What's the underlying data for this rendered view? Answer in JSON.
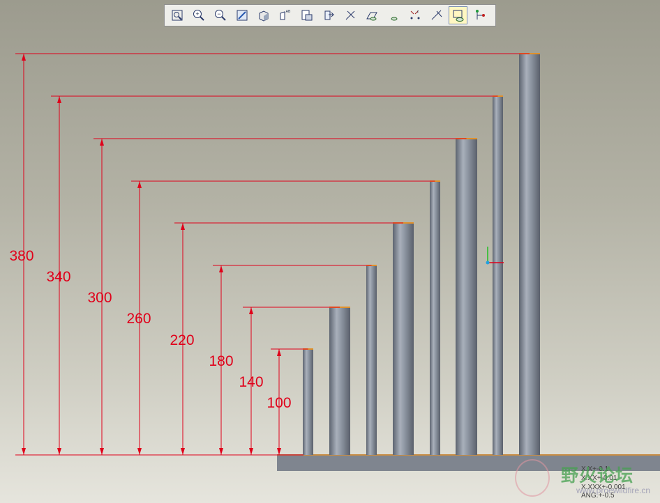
{
  "toolbar": {
    "buttons": [
      {
        "icon": "refit-icon",
        "label": "Refit"
      },
      {
        "icon": "zoom-in-icon",
        "label": "Zoom In"
      },
      {
        "icon": "zoom-out-icon",
        "label": "Zoom Out"
      },
      {
        "icon": "repaint-icon",
        "label": "Repaint"
      },
      {
        "icon": "shading-icon",
        "label": "Shading"
      },
      {
        "icon": "view-manager-icon",
        "label": "View Manager"
      },
      {
        "icon": "saved-views-icon",
        "label": "Saved Views"
      },
      {
        "icon": "orient-icon",
        "label": "Orient"
      },
      {
        "icon": "datum-planes-icon",
        "label": "Datum Planes"
      },
      {
        "icon": "datum-axes-icon",
        "label": "Datum Axes"
      },
      {
        "icon": "datum-points-icon",
        "label": "Datum Points"
      },
      {
        "icon": "coordinate-systems-icon",
        "label": "Coordinate Systems"
      },
      {
        "icon": "spin-center-icon",
        "label": "Spin Center"
      },
      {
        "icon": "annotation-display-icon",
        "label": "Annotation Display",
        "active": true
      },
      {
        "icon": "model-tree-icon",
        "label": "Model Tree"
      }
    ],
    "glyphs": {
      "zoom_in": "+",
      "zoom_out": "−",
      "view_label": "AB",
      "axes_label": "/",
      "coord_label": "z"
    }
  },
  "dimensions": {
    "values": [
      "380",
      "340",
      "300",
      "260",
      "220",
      "180",
      "140",
      "100"
    ],
    "color": "#e0001a",
    "unit": ""
  },
  "model": {
    "pillar_color": "#808894",
    "top_edge_color": "#e0902a",
    "base_color": "#7f858f"
  },
  "tolerance_table": {
    "lines": [
      "X.X+-0.1",
      "X.XX+-0.01",
      "X.XXX+-0.001",
      "ANG.+-0.5"
    ]
  },
  "watermark": {
    "title": "野火论坛",
    "url": "www.proewildfire.cn"
  }
}
